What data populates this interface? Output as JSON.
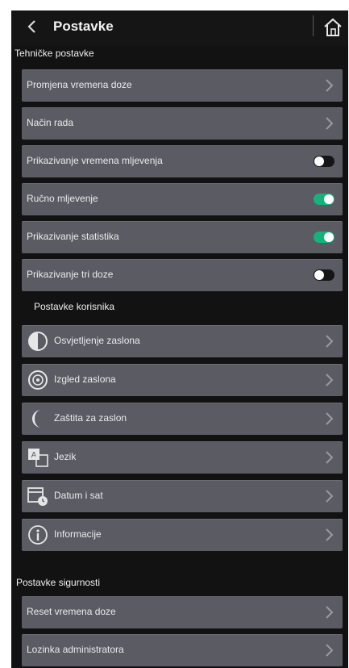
{
  "header": {
    "title": "Postavke"
  },
  "sections": {
    "technical": "Tehničke postavke",
    "user": "Postavke korisnika",
    "security": "Postavke sigurnosti"
  },
  "technical_items": [
    {
      "label": "Promjena vremena doze",
      "control": "chevron"
    },
    {
      "label": "Način rada",
      "control": "chevron"
    },
    {
      "label": "Prikazivanje vremena mljevenja",
      "control": "toggle",
      "on": false
    },
    {
      "label": "Ručno mljevenje",
      "control": "toggle",
      "on": true
    },
    {
      "label": "Prikazivanje statistika",
      "control": "toggle",
      "on": true
    },
    {
      "label": "Prikazivanje tri doze",
      "control": "toggle",
      "on": false
    }
  ],
  "user_items": [
    {
      "label": "Osvjetljenje zaslona",
      "icon": "brightness-icon"
    },
    {
      "label": "Izgled zaslona",
      "icon": "display-style-icon"
    },
    {
      "label": "Zaštita za zaslon",
      "icon": "screensaver-moon-icon"
    },
    {
      "label": "Jezik",
      "icon": "language-icon"
    },
    {
      "label": "Datum i sat",
      "icon": "calendar-clock-icon"
    },
    {
      "label": "Informacije",
      "icon": "info-icon"
    }
  ],
  "security_items": [
    {
      "label": "Reset vremena doze",
      "control": "chevron"
    },
    {
      "label": "Lozinka administratora",
      "control": "chevron"
    }
  ],
  "colors": {
    "background": "#121212",
    "row": "#5a5b63",
    "toggle_on": "#15b37a",
    "text": "#ececec"
  }
}
